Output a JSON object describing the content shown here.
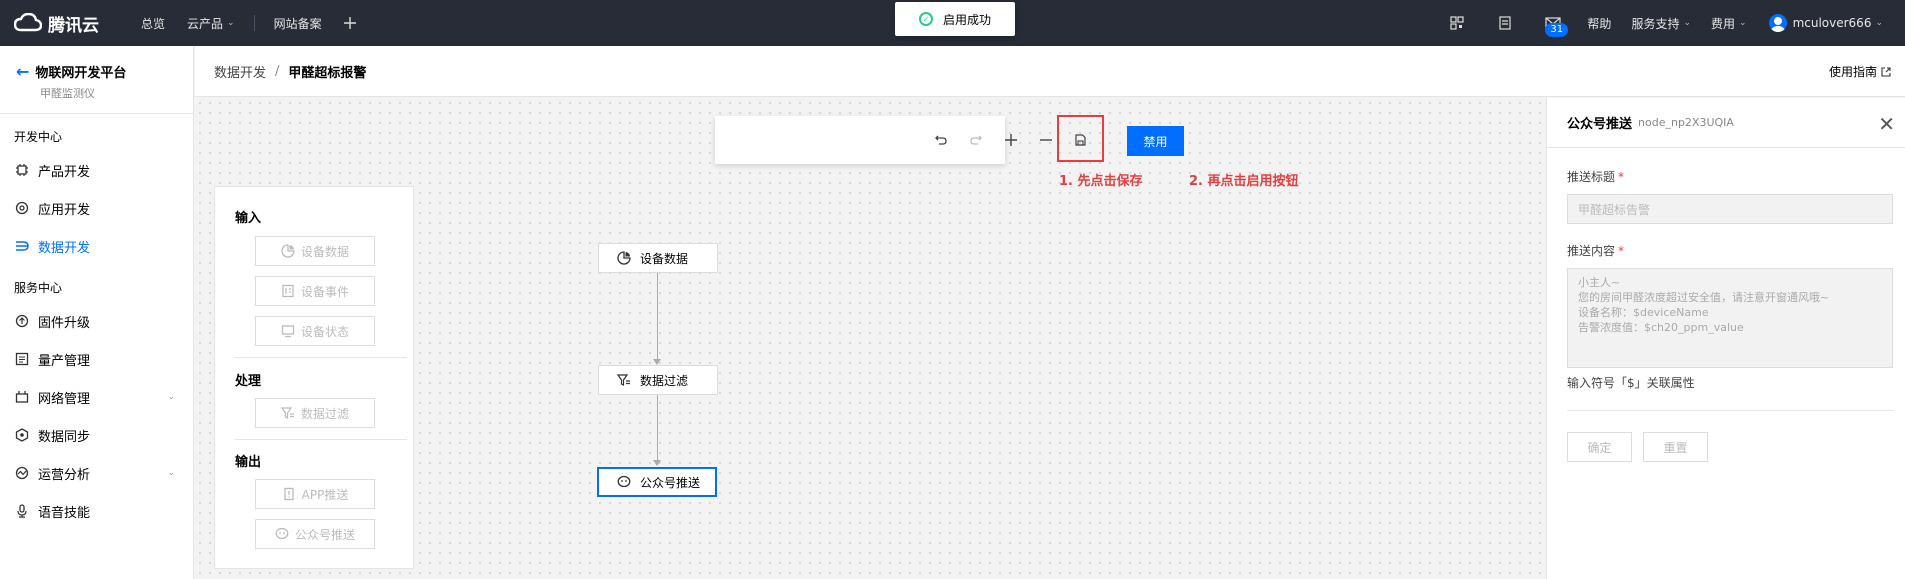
{
  "topbar": {
    "logo_text": "腾讯云",
    "nav": [
      {
        "label": "总览"
      },
      {
        "label": "云产品"
      },
      {
        "label": "网站备案"
      }
    ],
    "toast": "启用成功",
    "mail_badge": "31",
    "help": "帮助",
    "support": "服务支持",
    "billing": "费用",
    "username": "mculover666"
  },
  "sidebar": {
    "title": "物联网开发平台",
    "subtitle": "甲醛监测仪",
    "group_dev": "开发中心",
    "group_service": "服务中心",
    "items": [
      {
        "label": "产品开发",
        "icon": "chip-icon"
      },
      {
        "label": "应用开发",
        "icon": "gear-icon"
      },
      {
        "label": "数据开发",
        "icon": "flow-icon"
      },
      {
        "label": "固件升级",
        "icon": "upgrade-icon"
      },
      {
        "label": "量产管理",
        "icon": "list-icon"
      },
      {
        "label": "网络管理",
        "icon": "network-icon"
      },
      {
        "label": "数据同步",
        "icon": "sync-icon"
      },
      {
        "label": "运营分析",
        "icon": "analytics-icon"
      },
      {
        "label": "语音技能",
        "icon": "voice-icon"
      }
    ]
  },
  "header": {
    "crumb_parent": "数据开发",
    "crumb_sep": "/",
    "crumb_current": "甲醛超标报警",
    "guide": "使用指南"
  },
  "toolbar": {
    "enable": "禁用",
    "annot1": "1. 先点击保存",
    "annot2": "2. 再点击启用按钮"
  },
  "palette": {
    "input_title": "输入",
    "process_title": "处理",
    "output_title": "输出",
    "items": [
      "设备数据",
      "设备事件",
      "设备状态",
      "数据过滤",
      "APP推送",
      "公众号推送"
    ]
  },
  "flow": {
    "nodes": [
      "设备数据",
      "数据过滤",
      "公众号推送"
    ]
  },
  "panel": {
    "title": "公众号推送",
    "node_id": "node_np2X3UQIA",
    "title_label": "推送标题",
    "title_value": "甲醛超标告警",
    "content_label": "推送内容",
    "content_lines": [
      "小主人~",
      "您的房间甲醛浓度超过安全值，请注意开窗通风哦~",
      "设备名称：$deviceName",
      "告警浓度值：$ch20_ppm_value"
    ],
    "hint": "输入符号「$」关联属性",
    "confirm": "确定",
    "reset": "重置",
    "required_mark": "*"
  }
}
